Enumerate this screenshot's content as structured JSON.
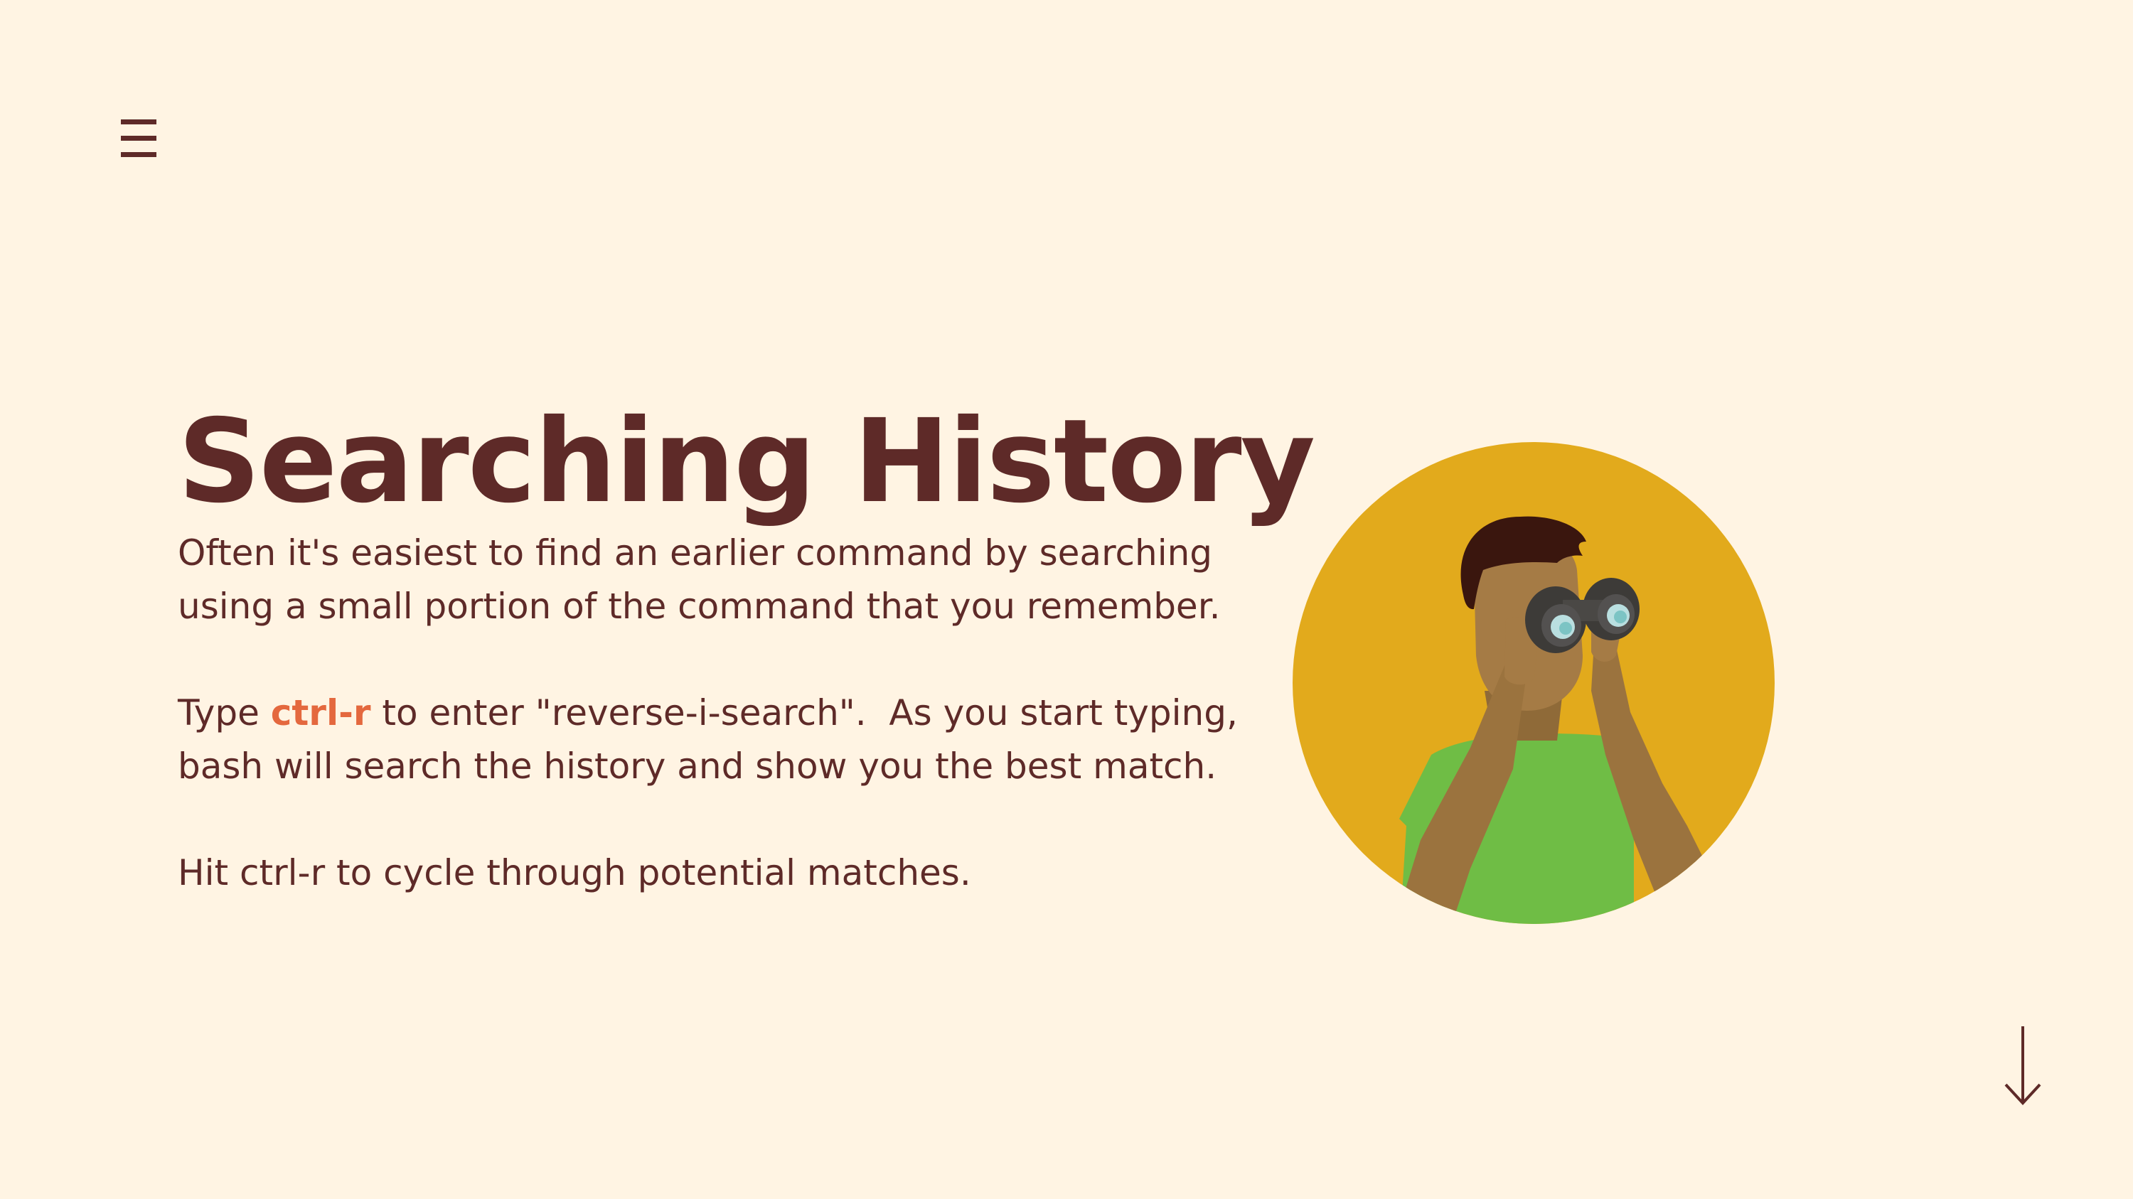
{
  "slide": {
    "title": "Searching History",
    "paragraph1_line1": "Often it's easiest to find an earlier command by searching",
    "paragraph1_line2": "using a small portion of the command that you remember.",
    "paragraph2_prefix": "Type ",
    "paragraph2_highlight": "ctrl-r",
    "paragraph2_line1_suffix": " to enter \"reverse-i-search\".  As you start typing,",
    "paragraph2_line2": "bash will search the history and show you the best match.",
    "paragraph3": "Hit ctrl-r to cycle through potential matches."
  },
  "icons": {
    "menu": "hamburger-menu-icon",
    "scroll": "arrow-down-icon",
    "illustration": "person-with-binoculars"
  },
  "colors": {
    "background": "#fff4e3",
    "text": "#5e2a28",
    "accent": "#e4683e",
    "circle": "#e2aa1c",
    "shirt": "#6fbd45",
    "skin": "#a57b45",
    "hair": "#3a160e"
  }
}
